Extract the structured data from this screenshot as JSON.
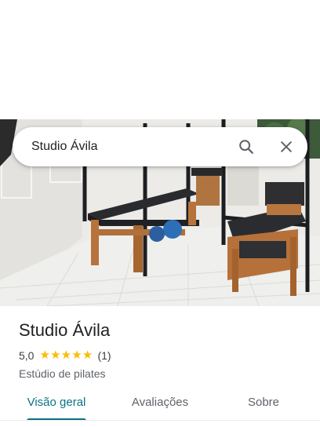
{
  "search": {
    "query": "Studio Ávila",
    "search_icon": "search-icon",
    "close_icon": "close-icon"
  },
  "place": {
    "name": "Studio Ávila",
    "rating": "5,0",
    "stars": "★★★★★",
    "review_count": "(1)",
    "category": "Estúdio de pilates"
  },
  "photo": {
    "icon": "pilates-studio-photo"
  },
  "tabs": [
    {
      "label": "Visão geral",
      "active": true
    },
    {
      "label": "Avaliações",
      "active": false
    },
    {
      "label": "Sobre",
      "active": false
    }
  ],
  "colors": {
    "accent": "#0b7285",
    "star": "#fbbc04"
  }
}
